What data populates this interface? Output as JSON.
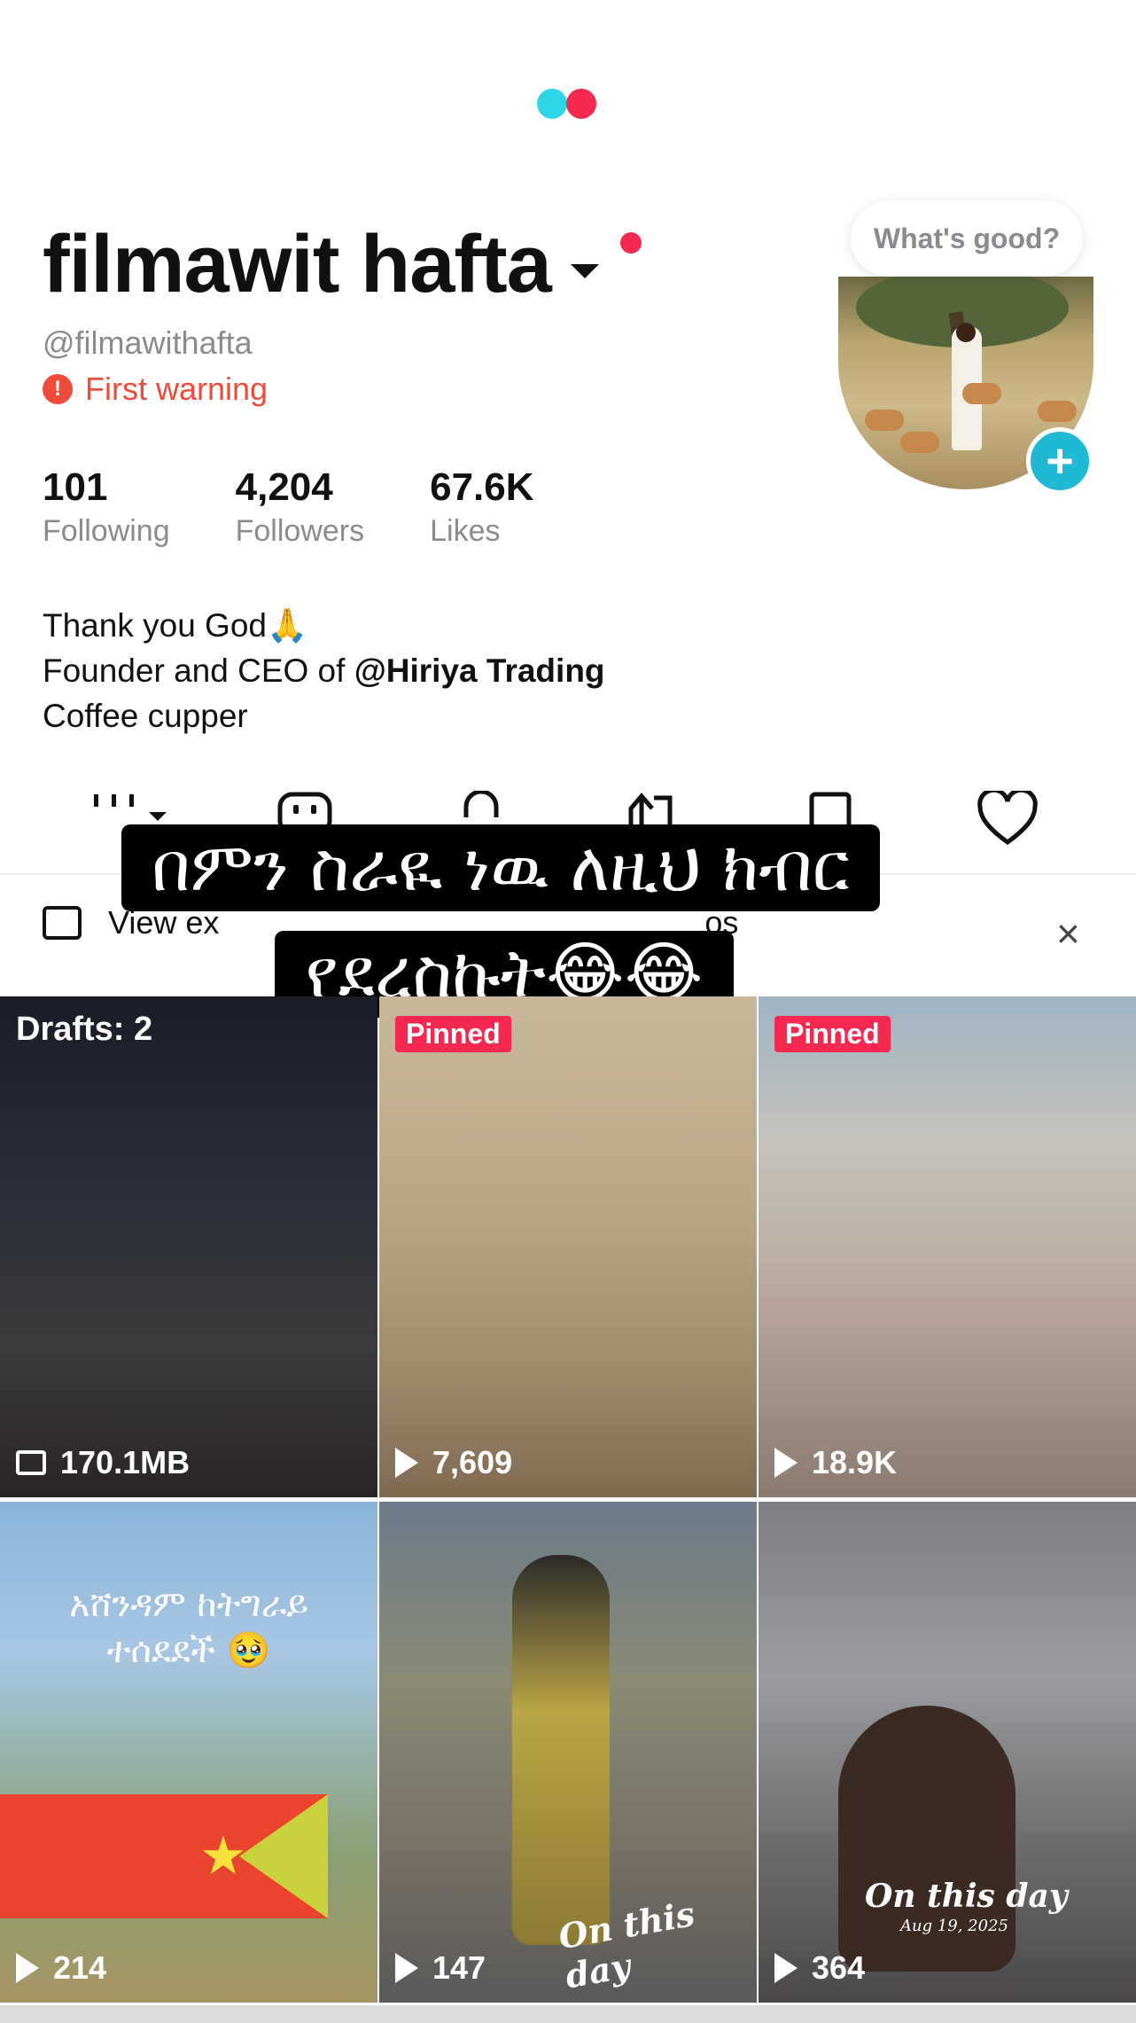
{
  "logo": {
    "colors": [
      "#2fd6e8",
      "#f5294f"
    ]
  },
  "profile": {
    "display_name": "filmawit hafta",
    "handle": "@filmawithafta",
    "warning": "First warning",
    "warning_icon": "exclamation-icon",
    "status_bubble": "What's good?",
    "add_button": "+"
  },
  "stats": [
    {
      "value": "101",
      "label": "Following"
    },
    {
      "value": "4,204",
      "label": "Followers"
    },
    {
      "value": "67.6K",
      "label": "Likes"
    }
  ],
  "bio": {
    "line1": "Thank you God🙏",
    "line2_prefix": "Founder and CEO of ",
    "line2_mention": "@Hiriya Trading",
    "line3": "Coffee cupper"
  },
  "tabs": [
    {
      "icon": "videos-grid-icon"
    },
    {
      "icon": "repost-bot-icon"
    },
    {
      "icon": "lock-icon"
    },
    {
      "icon": "share-icon"
    },
    {
      "icon": "bookmark-icon"
    },
    {
      "icon": "heart-icon"
    }
  ],
  "banner": {
    "text_start": "View ex",
    "text_end": "os",
    "close": "×"
  },
  "caption": {
    "line1": "በምን ስራዪ ነዉ ለዚህ ክብር",
    "line2": "የደረስኩት😂😂"
  },
  "videos": [
    {
      "type": "draft",
      "label": "Drafts: 2",
      "meta": "170.1MB"
    },
    {
      "type": "pinned",
      "badge": "Pinned",
      "meta": "7,609"
    },
    {
      "type": "pinned",
      "badge": "Pinned",
      "meta": "18.9K"
    },
    {
      "type": "video",
      "overlay_line1": "አሸንዳም ከትግራይ",
      "overlay_line2": "ተሰደደች 🥹",
      "meta": "214"
    },
    {
      "type": "video",
      "overlay_text": "On this day",
      "meta": "147"
    },
    {
      "type": "video",
      "overlay_text": "On this day",
      "overlay_date": "Aug 19, 2025",
      "meta": "364"
    }
  ],
  "colors": {
    "accent_red": "#f5294f",
    "warning": "#f04b3a",
    "add_button": "#1fb9d6",
    "muted_text": "#8a8a8f"
  }
}
